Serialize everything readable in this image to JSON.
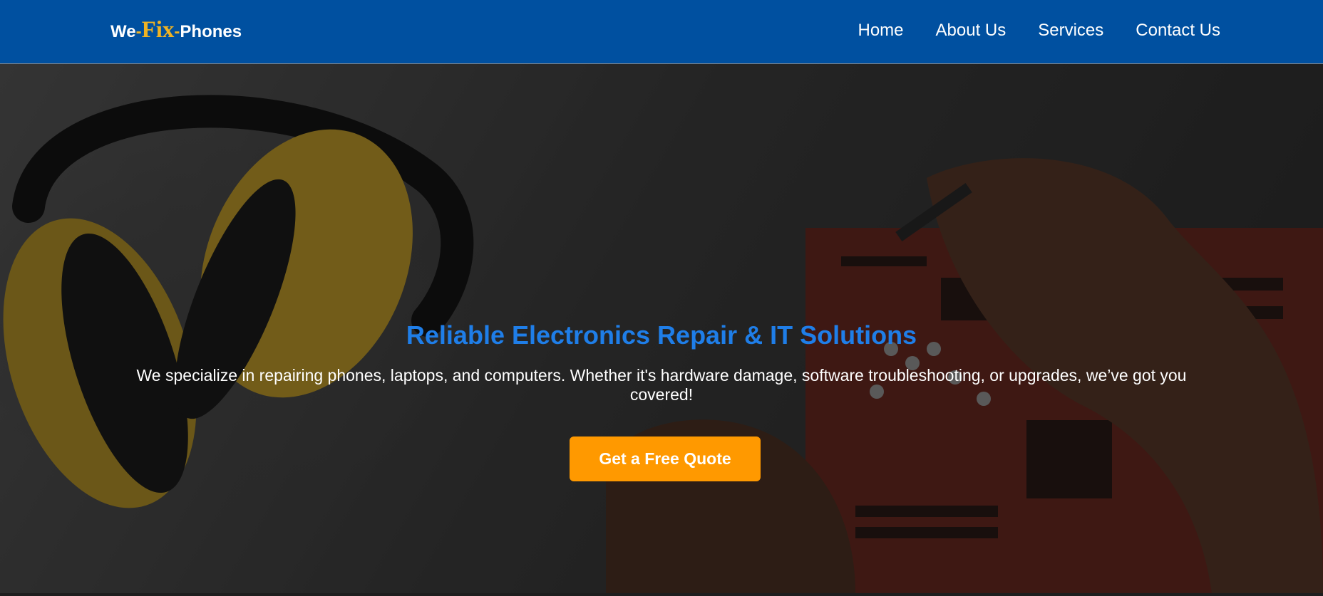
{
  "brand": {
    "logo_we": "We",
    "logo_dash1": "-",
    "logo_fix": "Fix",
    "logo_dash2": "-",
    "logo_phones": "Phones",
    "primary_color": "#0050a0",
    "accent_color": "#f0b323"
  },
  "nav": {
    "items": [
      {
        "label": "Home"
      },
      {
        "label": "About Us"
      },
      {
        "label": "Services"
      },
      {
        "label": "Contact Us"
      }
    ]
  },
  "hero": {
    "title": "Reliable Electronics Repair & IT Solutions",
    "description": "We specialize in repairing phones, laptops, and computers. Whether it's hardware damage, software troubleshooting, or upgrades, we’ve got you covered!",
    "cta_label": "Get a Free Quote",
    "title_color": "#1f7ee8",
    "cta_color": "#ff9900",
    "background_image": "headphones-and-circuit-board-repair-photo"
  }
}
